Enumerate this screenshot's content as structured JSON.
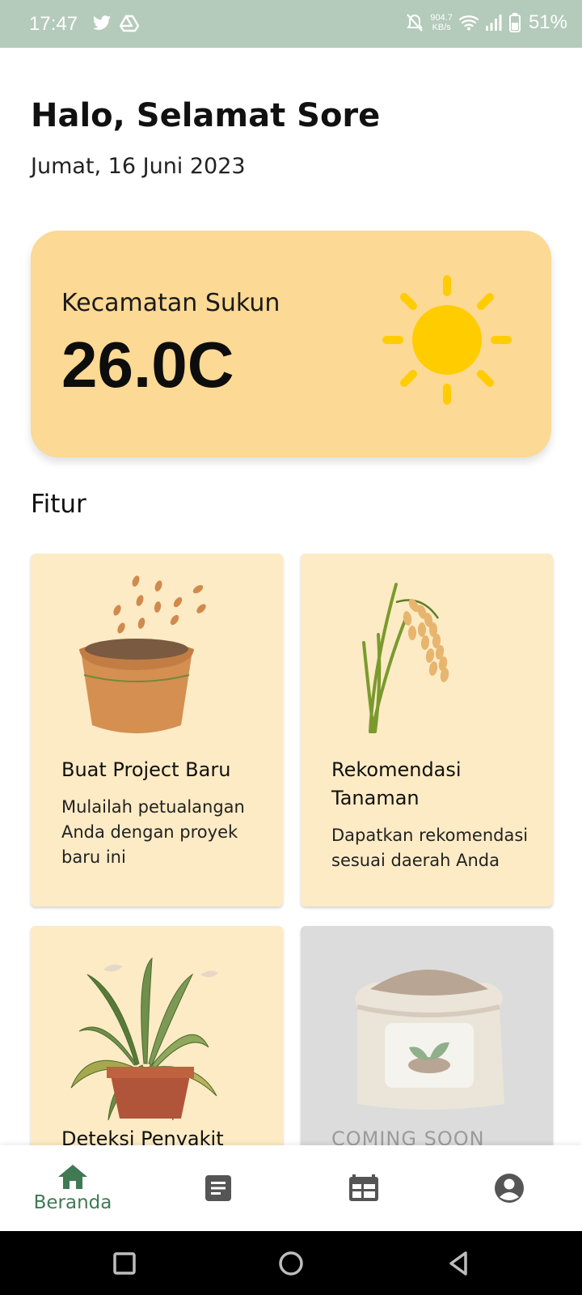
{
  "status_bar": {
    "time": "17:47",
    "net_speed_value": "904.7",
    "net_speed_unit": "KB/s",
    "battery": "51%",
    "left_icons": [
      "twitter-icon",
      "drive-icon"
    ],
    "right_icons": [
      "mute-icon",
      "wifi-icon",
      "signal-icon",
      "battery-icon"
    ]
  },
  "header": {
    "greeting": "Halo, Selamat Sore",
    "date": "Jumat, 16 Juni 2023"
  },
  "weather": {
    "location": "Kecamatan Sukun",
    "temperature": "26.0C",
    "icon": "sun-icon",
    "card_color": "#fcd994",
    "sun_color": "#ffcc00"
  },
  "features": {
    "section_title": "Fitur",
    "cards": [
      {
        "title": "Buat Project Baru",
        "description": "Mulailah petualangan Anda dengan proyek baru ini",
        "icon": "flower-pot-icon"
      },
      {
        "title": "Rekomendasi Tanaman",
        "description": "Dapatkan rekomendasi sesuai daerah Anda",
        "icon": "rice-plant-icon"
      },
      {
        "title": "Deteksi Penyakit",
        "description": "",
        "icon": "wilted-plant-icon"
      },
      {
        "title": "COMING SOON",
        "description": "",
        "icon": "seed-bag-icon"
      }
    ],
    "card_color": "#fdebc5",
    "disabled_card_color": "#dcdcdc"
  },
  "bottom_nav": {
    "items": [
      {
        "label": "Beranda",
        "icon": "home-icon",
        "active": true
      },
      {
        "label": "",
        "icon": "article-icon",
        "active": false
      },
      {
        "label": "",
        "icon": "calendar-icon",
        "active": false
      },
      {
        "label": "",
        "icon": "profile-icon",
        "active": false
      }
    ],
    "active_color": "#3f7a53",
    "inactive_color": "#555555"
  },
  "system_nav": {
    "buttons": [
      "recents-button",
      "home-button",
      "back-button"
    ]
  }
}
